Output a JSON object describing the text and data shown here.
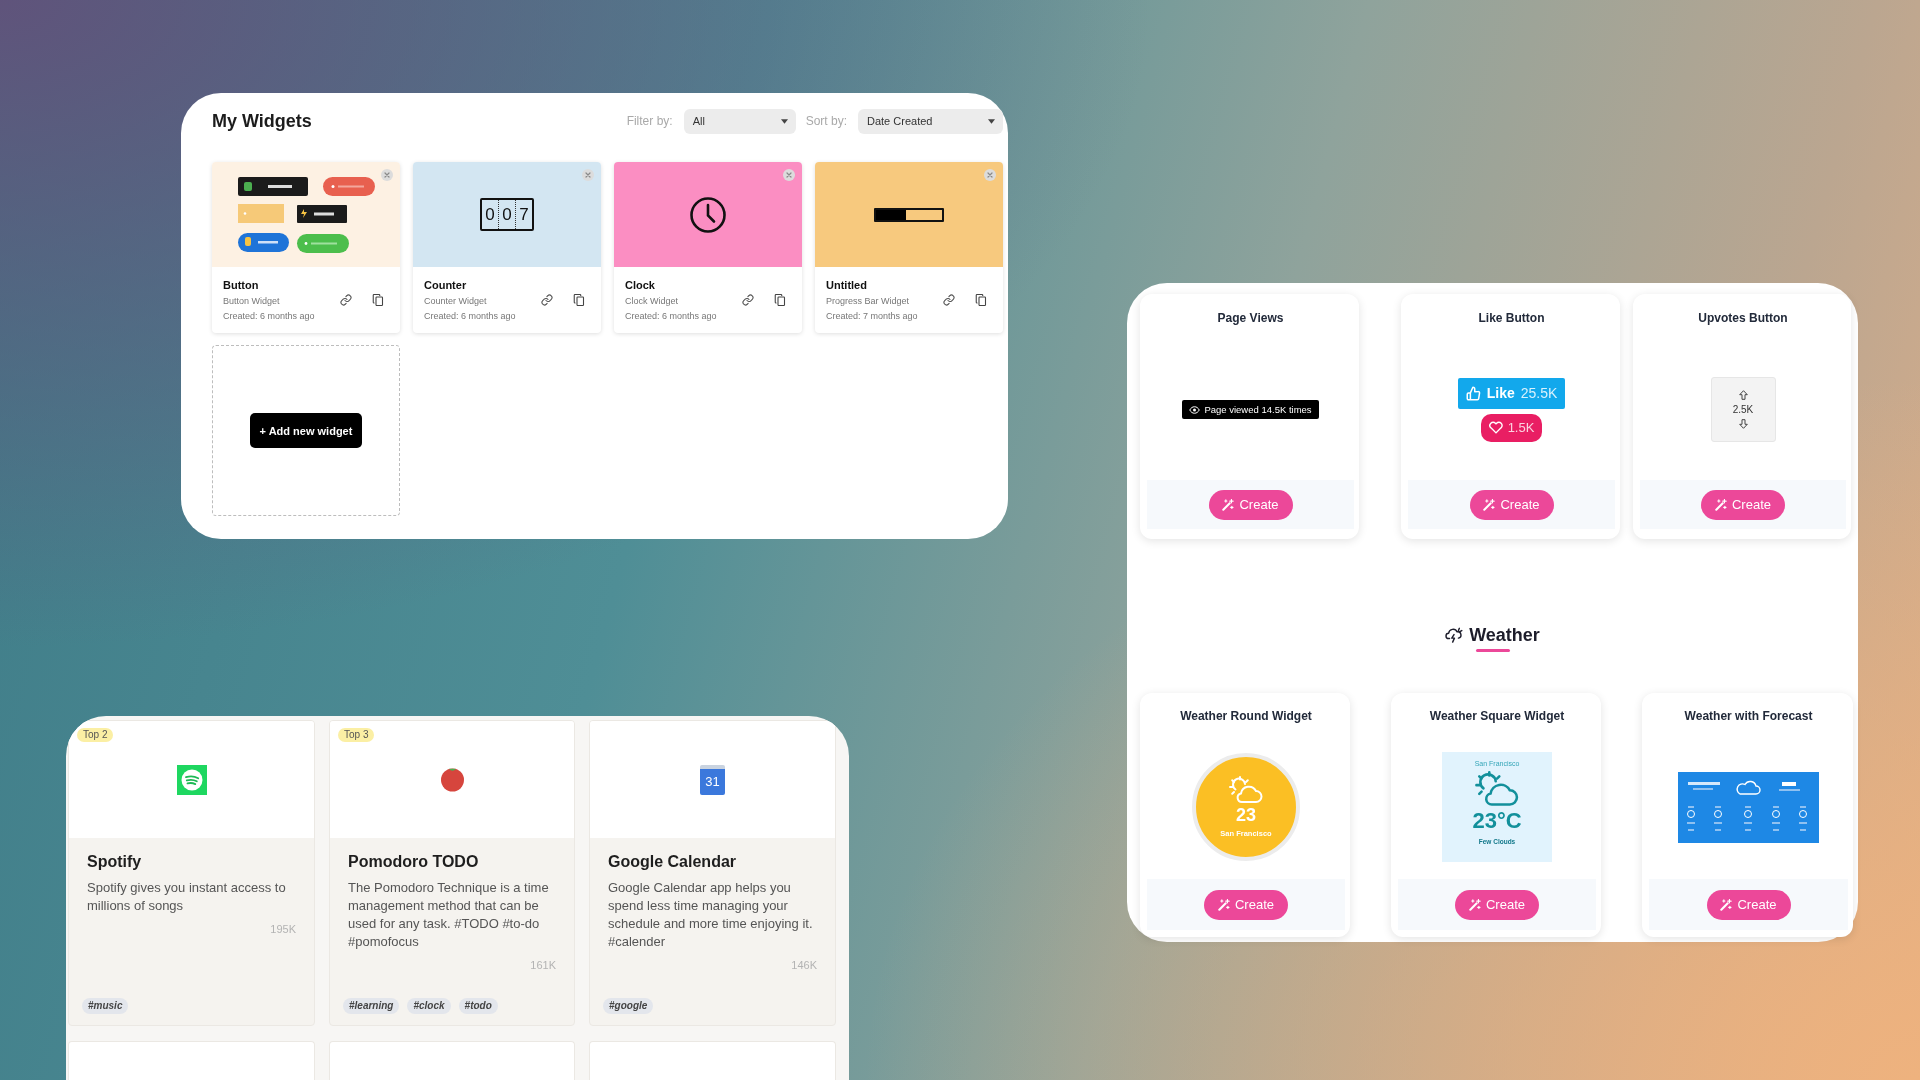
{
  "my_widgets": {
    "title": "My Widgets",
    "filter": {
      "label": "Filter by:",
      "value": "All"
    },
    "sort": {
      "label": "Sort by:",
      "value": "Date Created"
    },
    "widgets": [
      {
        "kind": "buttons",
        "name": "Button",
        "type": "Button Widget",
        "created": "Created: 6 months ago"
      },
      {
        "kind": "counter",
        "name": "Counter",
        "type": "Counter Widget",
        "created": "Created: 6 months ago",
        "digits": [
          "0",
          "0",
          "7"
        ]
      },
      {
        "kind": "clock",
        "name": "Clock",
        "type": "Clock Widget",
        "created": "Created: 6 months ago"
      },
      {
        "kind": "progress",
        "name": "Untitled",
        "type": "Progress Bar Widget",
        "created": "Created: 7 months ago",
        "level": 0.45
      }
    ],
    "add_button": "+ Add new widget"
  },
  "templates": {
    "cards": [
      {
        "kind": "page_views",
        "title": "Page Views",
        "text": "Page viewed 14.5K times",
        "action": "Create"
      },
      {
        "kind": "like",
        "title": "Like Button",
        "like_label": "Like",
        "like_count": "25.5K",
        "heart_count": "1.5K",
        "action": "Create"
      },
      {
        "kind": "upvotes",
        "title": "Upvotes Button",
        "count": "2.5K",
        "action": "Create"
      }
    ],
    "section_title": "Weather",
    "weather_cards": [
      {
        "kind": "round",
        "title": "Weather Round Widget",
        "temp": "23",
        "city": "San Francisco",
        "action": "Create"
      },
      {
        "kind": "square",
        "title": "Weather Square Widget",
        "city": "San Francisco",
        "temp": "23°C",
        "condition": "Few Clouds",
        "action": "Create"
      },
      {
        "kind": "forecast",
        "title": "Weather with Forecast",
        "action": "Create"
      }
    ]
  },
  "apps": {
    "cards": [
      {
        "kind": "spotify",
        "badge": "Top 2",
        "name": "Spotify",
        "description": "Spotify gives you instant access to millions of songs",
        "count": "195K",
        "tags": [
          "#music"
        ]
      },
      {
        "kind": "tomato",
        "badge": "Top 3",
        "name": "Pomodoro TODO",
        "description": "The Pomodoro Technique is a time management method that can be used for any task. #TODO #to-do #pomofocus",
        "count": "161K",
        "tags": [
          "#learning",
          "#clock",
          "#todo"
        ]
      },
      {
        "kind": "calendar",
        "icon_text": "31",
        "name": "Google Calendar",
        "description": "Google Calendar app helps you spend less time managing your schedule and more time enjoying it. #calender",
        "count": "146K",
        "tags": [
          "#google"
        ]
      }
    ]
  }
}
